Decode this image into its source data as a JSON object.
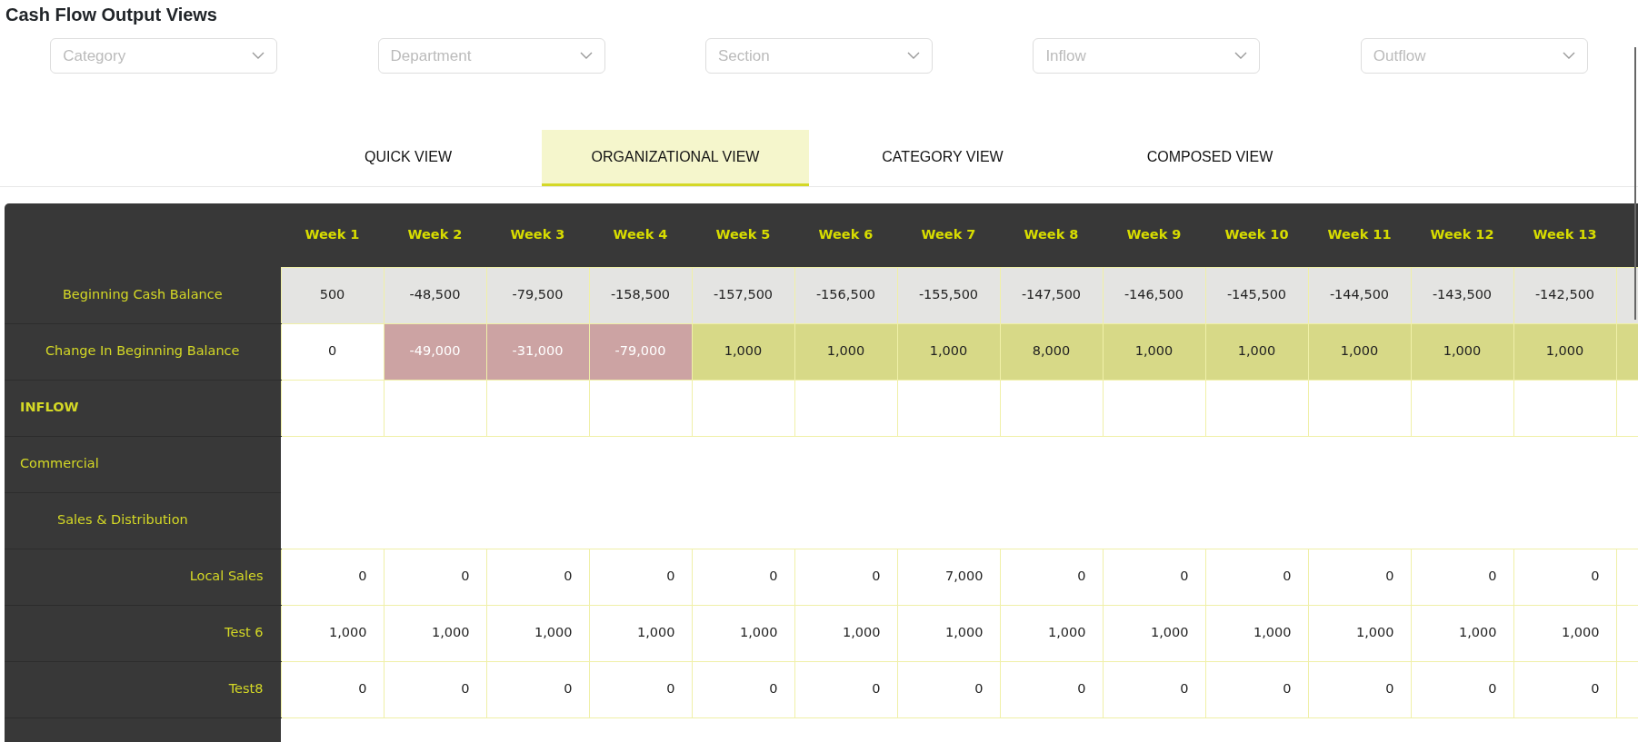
{
  "title": "Cash Flow Output Views",
  "filters": [
    {
      "placeholder": "Category"
    },
    {
      "placeholder": "Department"
    },
    {
      "placeholder": "Section"
    },
    {
      "placeholder": "Inflow"
    },
    {
      "placeholder": "Outflow"
    }
  ],
  "tabs": [
    {
      "label": "QUICK VIEW",
      "selected": false
    },
    {
      "label": "ORGANIZATIONAL VIEW",
      "selected": true
    },
    {
      "label": "CATEGORY VIEW",
      "selected": false
    },
    {
      "label": "COMPOSED VIEW",
      "selected": false
    }
  ],
  "table": {
    "columns": [
      "Week 1",
      "Week 2",
      "Week 3",
      "Week 4",
      "Week 5",
      "Week 6",
      "Week 7",
      "Week 8",
      "Week 9",
      "Week 10",
      "Week 11",
      "Week 12",
      "Week 13"
    ],
    "rows": [
      {
        "kind": "balance",
        "label": "Beginning Cash Balance",
        "values": [
          "500",
          "-48,500",
          "-79,500",
          "-158,500",
          "-157,500",
          "-156,500",
          "-155,500",
          "-147,500",
          "-146,500",
          "-145,500",
          "-144,500",
          "-143,500",
          "-142,500"
        ]
      },
      {
        "kind": "change",
        "label": "Change In Beginning Balance",
        "cells": [
          {
            "value": "0",
            "color": "#ffffff"
          },
          {
            "value": "-49,000",
            "color": "#cca3a3"
          },
          {
            "value": "-31,000",
            "color": "#cca3a3"
          },
          {
            "value": "-79,000",
            "color": "#cca3a3"
          },
          {
            "value": "1,000",
            "color": "#d7d987"
          },
          {
            "value": "1,000",
            "color": "#d7d987"
          },
          {
            "value": "1,000",
            "color": "#d7d987"
          },
          {
            "value": "8,000",
            "color": "#d7d987"
          },
          {
            "value": "1,000",
            "color": "#d7d987"
          },
          {
            "value": "1,000",
            "color": "#d7d987"
          },
          {
            "value": "1,000",
            "color": "#d7d987"
          },
          {
            "value": "1,000",
            "color": "#d7d987"
          },
          {
            "value": "1,000",
            "color": "#d7d987"
          }
        ]
      },
      {
        "kind": "section",
        "label": "INFLOW"
      },
      {
        "kind": "group",
        "label": "Commercial"
      },
      {
        "kind": "subgroup",
        "label": "Sales & Distribution"
      },
      {
        "kind": "item",
        "label": "Local Sales",
        "values": [
          "0",
          "0",
          "0",
          "0",
          "0",
          "0",
          "7,000",
          "0",
          "0",
          "0",
          "0",
          "0",
          "0"
        ]
      },
      {
        "kind": "item",
        "label": "Test 6",
        "values": [
          "1,000",
          "1,000",
          "1,000",
          "1,000",
          "1,000",
          "1,000",
          "1,000",
          "1,000",
          "1,000",
          "1,000",
          "1,000",
          "1,000",
          "1,000"
        ]
      },
      {
        "kind": "item",
        "label": "Test8",
        "values": [
          "0",
          "0",
          "0",
          "0",
          "0",
          "0",
          "0",
          "0",
          "0",
          "0",
          "0",
          "0",
          "0"
        ]
      }
    ]
  }
}
